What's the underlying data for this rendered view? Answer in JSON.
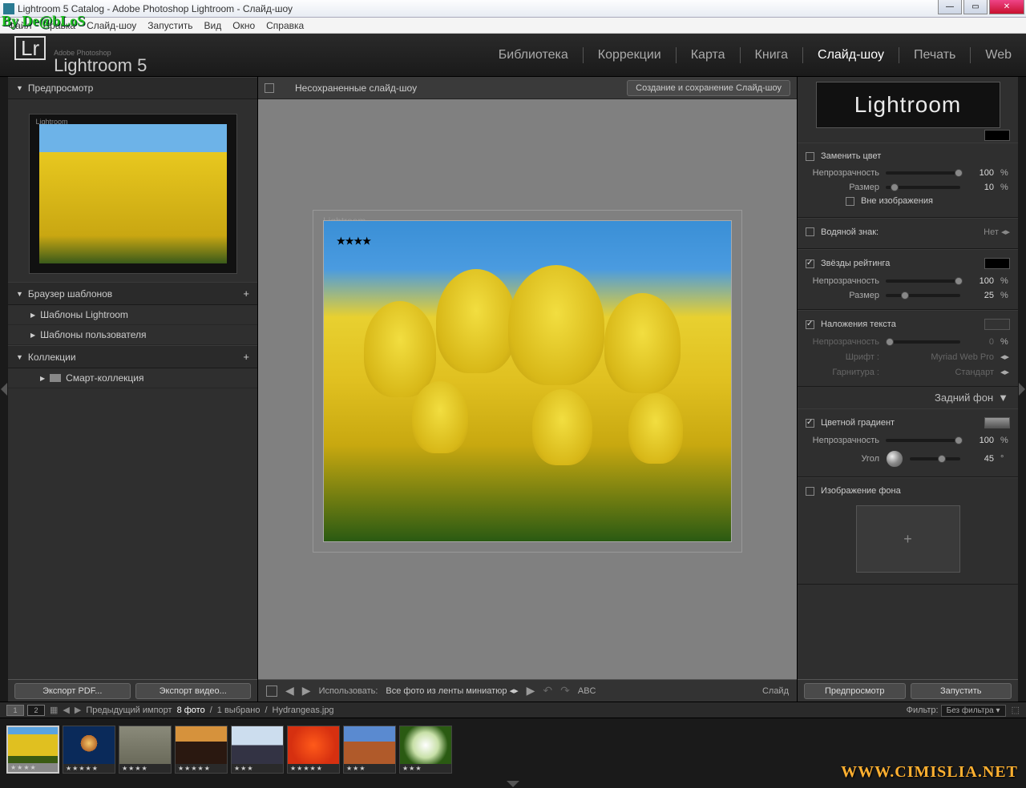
{
  "window": {
    "title": "Lightroom 5 Catalog - Adobe Photoshop Lightroom - Слайд-шоу",
    "overlay_tag": "By De@bLoS"
  },
  "menubar": [
    "Файл",
    "Правка",
    "Слайд-шоу",
    "Запустить",
    "Вид",
    "Окно",
    "Справка"
  ],
  "logo": {
    "small": "Adobe Photoshop",
    "big": "Lightroom 5",
    "lr": "Lr"
  },
  "modules": [
    {
      "label": "Библиотека",
      "active": false
    },
    {
      "label": "Коррекции",
      "active": false
    },
    {
      "label": "Карта",
      "active": false
    },
    {
      "label": "Книга",
      "active": false
    },
    {
      "label": "Слайд-шоу",
      "active": true
    },
    {
      "label": "Печать",
      "active": false
    },
    {
      "label": "Web",
      "active": false
    }
  ],
  "left": {
    "preview_header": "Предпросмотр",
    "preview_wm": "Lightroom",
    "templates_header": "Браузер шаблонов",
    "templates": [
      "Шаблоны Lightroom",
      "Шаблоны пользователя"
    ],
    "collections_header": "Коллекции",
    "collections": [
      "Смарт-коллекция"
    ],
    "export_pdf": "Экспорт PDF...",
    "export_video": "Экспорт видео..."
  },
  "center": {
    "title": "Несохраненные слайд-шоу",
    "save_btn": "Создание и сохранение Слайд-шоу",
    "wm": "Lightroom",
    "stars": "★★★★",
    "use_label": "Использовать:",
    "use_value": "Все фото из ленты миниатюр",
    "abc": "ABC",
    "slide_label": "Слайд"
  },
  "right": {
    "identity": "Lightroom",
    "replace_color": "Заменить цвет",
    "opacity_label": "Непрозрачность",
    "size_label": "Размер",
    "opacity1": "100",
    "opacity1_unit": "%",
    "size1": "10",
    "size1_unit": "%",
    "outside": "Вне изображения",
    "watermark": "Водяной знак:",
    "watermark_val": "Нет",
    "stars_header": "Звёзды рейтинга",
    "opacity2": "100",
    "opacity2_unit": "%",
    "size2": "25",
    "size2_unit": "%",
    "text_overlay": "Наложения текста",
    "opacity3": "0",
    "opacity3_unit": "%",
    "font_label": "Шрифт :",
    "font_val": "Myriad Web Pro",
    "face_label": "Гарнитура :",
    "face_val": "Стандарт",
    "bg_header": "Задний фон",
    "gradient": "Цветной градиент",
    "opacity4": "100",
    "opacity4_unit": "%",
    "angle_label": "Угол",
    "angle_val": "45",
    "angle_unit": "°",
    "bg_image": "Изображение фона",
    "preview_btn": "Предпросмотр",
    "run_btn": "Запустить"
  },
  "filmbar": {
    "prev_import": "Предыдущий импорт",
    "count": "8 фото",
    "selected": "1 выбрано",
    "filename": "Hydrangeas.jpg",
    "filter_label": "Фильтр:",
    "filter_val": "Без фильтра",
    "screen1": "1",
    "screen2": "2"
  },
  "thumbs": [
    {
      "stars": "★★★★",
      "bg": "linear-gradient(#5aa3e0 20%,#e0c020 20% 80%,#3a5a12 80%)",
      "sel": true
    },
    {
      "stars": "★★★★★",
      "bg": "radial-gradient(circle at 50% 45%,#f5c76a 0%,#b86a2a 25%,#0a2a5a 25%)"
    },
    {
      "stars": "★★★★",
      "bg": "linear-gradient(#8a8a7a,#6a6a5a)"
    },
    {
      "stars": "★★★★★",
      "bg": "linear-gradient(#d6923c 40%,#2a1810 40%)"
    },
    {
      "stars": "★★★",
      "bg": "linear-gradient(#cde 50%,#334 50%)"
    },
    {
      "stars": "★★★★★",
      "bg": "radial-gradient(circle,#ff5a1a 0%,#d63010 70%)"
    },
    {
      "stars": "★★★",
      "bg": "linear-gradient(#5a8ad0 40%,#b05a2a 40%)"
    },
    {
      "stars": "★★★",
      "bg": "radial-gradient(circle,#fff 0%,#c8e0a8 40%,#2a5a12 70%)"
    }
  ],
  "watermark_url": "WWW.CIMISLIA.NET"
}
